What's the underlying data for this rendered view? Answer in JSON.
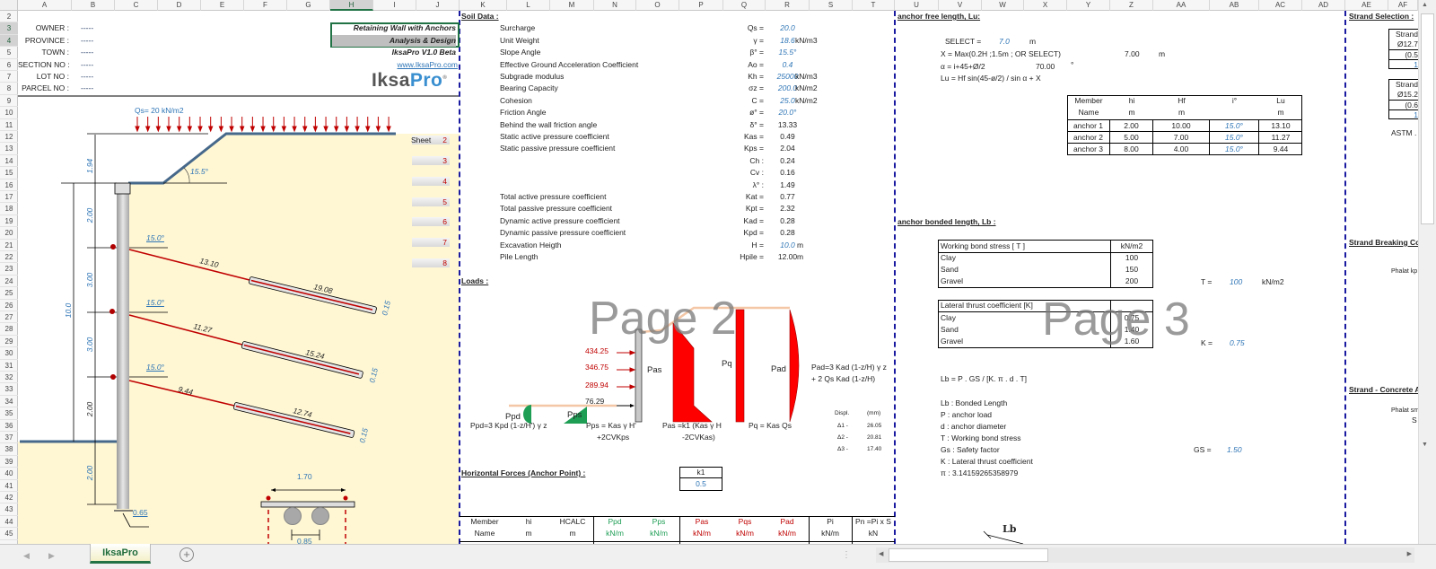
{
  "col_headers": [
    "A",
    "B",
    "C",
    "D",
    "E",
    "F",
    "G",
    "H",
    "I",
    "J",
    "K",
    "L",
    "M",
    "N",
    "O",
    "P",
    "Q",
    "R",
    "S",
    "T",
    "U",
    "V",
    "W",
    "X",
    "Y",
    "Z",
    "AA",
    "AB",
    "AC",
    "AD",
    "AE",
    "AF"
  ],
  "row_headers": [
    "2",
    "3",
    "4",
    "5",
    "6",
    "7",
    "8",
    "9",
    "10",
    "11",
    "12",
    "13",
    "14",
    "15",
    "16",
    "17",
    "18",
    "19",
    "20",
    "21",
    "22",
    "23",
    "24",
    "25",
    "26",
    "27",
    "28",
    "29",
    "30",
    "31",
    "32",
    "33",
    "34",
    "35",
    "36",
    "37",
    "38",
    "39",
    "40",
    "41",
    "42",
    "43",
    "44",
    "45"
  ],
  "header_info": {
    "labels": [
      "OWNER :",
      "PROVINCE :",
      "TOWN :",
      "SECTION NO :",
      "LOT NO :",
      "PARCEL NO :"
    ],
    "values": [
      "-----",
      "-----",
      "-----",
      "-----",
      "-----",
      "-----"
    ]
  },
  "title": {
    "line1": "Retaining Wall with Anchors",
    "line2": "Analysis & Design",
    "version": "IksaPro V1.0 Beta",
    "website": "www.IksaPro.com",
    "logo_a": "Iksa",
    "logo_b": "Pro"
  },
  "drawing": {
    "surcharge": "Qs= 20 kN/m2",
    "slope_angle": "15.5°",
    "dims": [
      "1.94",
      "2.00",
      "3.00",
      "3.00",
      "2.00",
      "2.00"
    ],
    "total_height": "10.0",
    "pile_dia": "0.65",
    "anchors": [
      {
        "angle": "15.0°",
        "free": "13.10",
        "bond": "19.08",
        "dia": "0.15"
      },
      {
        "angle": "15.0°",
        "free": "11.27",
        "bond": "15.24",
        "dia": "0.15"
      },
      {
        "angle": "15.0°",
        "free": "9.44",
        "bond": "12.74",
        "dia": "0.15"
      }
    ],
    "spacing_top": "1.70",
    "spacing_bottom": "0.85",
    "sheet_label": "Sheet",
    "sheets": [
      "2",
      "3",
      "4",
      "5",
      "6",
      "7",
      "8"
    ]
  },
  "soil": {
    "title": "Soil Data :",
    "rows": [
      {
        "label": "Surcharge",
        "sym": "Qs =",
        "val": "20.0",
        "unit": "",
        "input": true
      },
      {
        "label": "Unit Weight",
        "sym": "γ =",
        "val": "18.6",
        "unit": "kN/m3",
        "input": true
      },
      {
        "label": "Slope Angle",
        "sym": "β° =",
        "val": "15.5°",
        "unit": "",
        "input": true
      },
      {
        "label": "Effective Ground Acceleration Coefficient",
        "sym": "Ao =",
        "val": "0.4",
        "unit": "",
        "input": true
      },
      {
        "label": "Subgrade modulus",
        "sym": "Kh =",
        "val": "25000",
        "unit": "kN/m3",
        "input": true
      },
      {
        "label": "Bearing Capacity",
        "sym": "σz =",
        "val": "200.0",
        "unit": "kN/m2",
        "input": true
      },
      {
        "label": "Cohesion",
        "sym": "C =",
        "val": "25.0",
        "unit": "kN/m2",
        "input": true
      },
      {
        "label": "Friction Angle",
        "sym": "ø° =",
        "val": "20.0°",
        "unit": "",
        "input": true
      },
      {
        "label": "Behind the wall friction angle",
        "sym": "δ° =",
        "val": "13.33",
        "unit": "",
        "input": false
      },
      {
        "label": "Static active pressure coefficient",
        "sym": "Kas =",
        "val": "0.49",
        "unit": "",
        "input": false
      },
      {
        "label": "Static passive pressure coefficient",
        "sym": "Kps =",
        "val": "2.04",
        "unit": "",
        "input": false
      },
      {
        "label": "",
        "sym": "Ch :",
        "val": "0.24",
        "unit": "",
        "input": false
      },
      {
        "label": "",
        "sym": "Cv :",
        "val": "0.16",
        "unit": "",
        "input": false
      },
      {
        "label": "",
        "sym": "λ° :",
        "val": "1.49",
        "unit": "",
        "input": false
      },
      {
        "label": "Total active pressure coefficient",
        "sym": "Kat =",
        "val": "0.77",
        "unit": "",
        "input": false
      },
      {
        "label": "Total passive pressure coefficient",
        "sym": "Kpt =",
        "val": "2.32",
        "unit": "",
        "input": false
      },
      {
        "label": "Dynamic active pressure coefficient",
        "sym": "Kad =",
        "val": "0.28",
        "unit": "",
        "input": false
      },
      {
        "label": "Dynamic passive pressure coefficient",
        "sym": "Kpd =",
        "val": "0.28",
        "unit": "",
        "input": false
      },
      {
        "label": "Excavation Heigth",
        "sym": "H =",
        "val": "10.0",
        "unit": "m",
        "input": true
      },
      {
        "label": "Pile Length",
        "sym": "Hpile =",
        "val": "12.00",
        "unit": "m",
        "input": false
      }
    ]
  },
  "loads": {
    "title": "Loads :",
    "watermark": "Page 2",
    "forces": [
      "434.25",
      "346.75",
      "289.94",
      "76.29"
    ],
    "labels": {
      "pas": "Pas",
      "pq": "Pq",
      "pad": "Pad",
      "ppd": "Ppd",
      "pps": "Pps"
    },
    "pad_formula": [
      "Pad=3 Kad (1-z/H) γ z",
      "+ 2 Qs Kad (1-z/H)"
    ],
    "ppd_formula": "Ppd=3 Kpd (1-z/H') γ z",
    "pps_formula": [
      "Pps = Kas γ H'",
      "+2CVKps"
    ],
    "pas_formula": [
      "Pas =k1 (Kas γ H",
      "-2CVKas)"
    ],
    "pq_formula": "Pq =  Kas Qs",
    "displ": {
      "title": "Displ.",
      "unit": "(mm)",
      "rows": [
        {
          "label": "Δ1 -",
          "val": "26.05"
        },
        {
          "label": "Δ2 -",
          "val": "20.81"
        },
        {
          "label": "Δ3 -",
          "val": "17.40"
        }
      ]
    },
    "hforces_title": "Horizontal Forces (Anchor Point) :",
    "k1_label": "k1",
    "k1_value": "0.5",
    "table_headers": [
      [
        "Member",
        "Name"
      ],
      [
        "hi",
        "m"
      ],
      [
        "HCALC",
        "m"
      ],
      [
        "Ppd",
        "kN/m"
      ],
      [
        "Pps",
        "kN/m"
      ],
      [
        "Pas",
        "kN/m"
      ],
      [
        "Pqs",
        "kN/m"
      ],
      [
        "Pad",
        "kN/m"
      ],
      [
        "Pi",
        "kN/m"
      ],
      [
        "Pn =Pi x S",
        "kN"
      ]
    ]
  },
  "free_length": {
    "title": "anchor free length, Lu:",
    "select_label": "SELECT =",
    "select_value": "7.0",
    "select_unit": "m",
    "x_formula": "X = Max(0.2H ;1.5m ; OR SELECT)",
    "x_value": "7.00",
    "x_unit": "m",
    "alpha_formula": "α = i+45+Ø/2",
    "alpha_value": "70.00",
    "alpha_unit": "°",
    "lu_formula": "Lu = Hf sin(45-ø/2) / sin α + X",
    "table_headers": [
      [
        "Member",
        "Name"
      ],
      [
        "hi",
        "m"
      ],
      [
        "Hf",
        "m"
      ],
      [
        "i°",
        ""
      ],
      [
        "Lu",
        "m"
      ]
    ],
    "table_rows": [
      [
        "anchor 1",
        "2.00",
        "10.00",
        "15.0°",
        "13.10"
      ],
      [
        "anchor 2",
        "5.00",
        "7.00",
        "15.0°",
        "11.27"
      ],
      [
        "anchor 3",
        "8.00",
        "4.00",
        "15.0°",
        "9.44"
      ]
    ]
  },
  "bonded_length": {
    "title": "anchor bonded length, Lb :",
    "watermark": "Page 3",
    "bond_table": {
      "header": "Working bond stress [ T ]",
      "unit": "kN/m2",
      "rows": [
        [
          "Clay",
          "100"
        ],
        [
          "Sand",
          "150"
        ],
        [
          "Gravel",
          "200"
        ]
      ]
    },
    "t_label": "T =",
    "t_value": "100",
    "t_unit": "kN/m2",
    "k_table": {
      "header": "Lateral thrust coefficient [K]",
      "rows": [
        [
          "Clay",
          "0.75"
        ],
        [
          "Sand",
          "1.40"
        ],
        [
          "Gravel",
          "1.60"
        ]
      ]
    },
    "k_label": "K =",
    "k_value": "0.75",
    "formula": "Lb = P . GS  / [K. π . d . T]",
    "legend": [
      "Lb : Bonded Length",
      "P : anchor load",
      "d : anchor diameter",
      "T : Working bond stress",
      "Gs : Safety factor",
      "K : Lateral thrust coefficient",
      "π : 3.14159265358979"
    ],
    "gs_label": "GS =",
    "gs_value": "1.50",
    "diagram_label": "Lb"
  },
  "strand": {
    "title": "Strand Selection :",
    "box1": [
      "Strand",
      "Ø12.7",
      "(0.5",
      "1"
    ],
    "box2": [
      "Strand",
      "Ø15.2",
      "(0.6",
      "1"
    ],
    "astm": "ASTM .",
    "breaking_title": "Strand Breaking Co",
    "p_halat_kp": "Phalat kp",
    "concrete_title": "Strand - Concrete A",
    "p_halat_sm": "Phalat sm",
    "s": "S"
  },
  "tabs": {
    "active": "IksaPro",
    "add": "+"
  }
}
